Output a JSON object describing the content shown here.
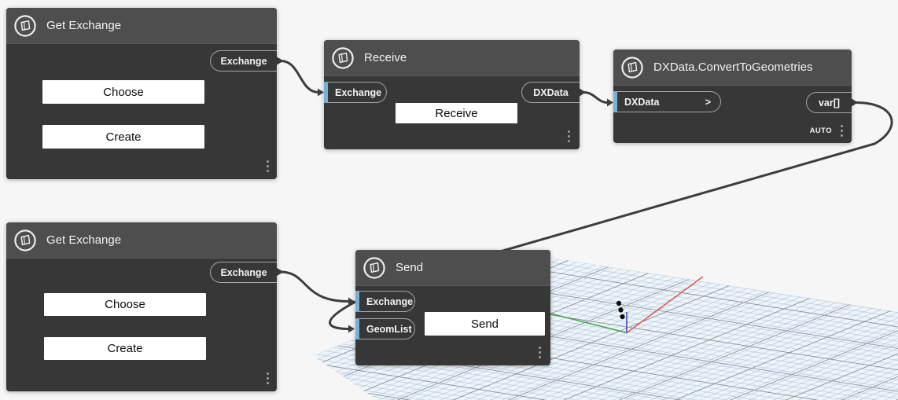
{
  "colors": {
    "canvas_bg": "#f6f6f7",
    "node_header": "#4e4e4e",
    "node_body": "#373737",
    "port_accent_blue": "#74b2d8",
    "wire": "#3d3d3d",
    "axis_x_red": "#e0534f",
    "axis_y_green": "#43a047",
    "axis_z_blue": "#5c6bc0",
    "button_bg": "#ffffff",
    "grid_fine_line": "#98bcda",
    "grid_major_line": "#808c96"
  },
  "nodes": {
    "get_exchange_top": {
      "title": "Get Exchange",
      "output_port": "Exchange",
      "choose_button": "Choose",
      "create_button": "Create"
    },
    "receive": {
      "title": "Receive",
      "input_port": "Exchange",
      "output_port": "DXData",
      "run_button": "Receive"
    },
    "convert_to_geometries": {
      "title": "DXData.ConvertToGeometries",
      "input_port": "DXData",
      "input_chevron": ">",
      "output_port": "var[]",
      "lacing_label": "AUTO"
    },
    "get_exchange_bottom": {
      "title": "Get Exchange",
      "output_port": "Exchange",
      "choose_button": "Choose",
      "create_button": "Create"
    },
    "send": {
      "title": "Send",
      "input_port_1": "Exchange",
      "input_port_2": "GeomList",
      "run_button": "Send"
    }
  }
}
